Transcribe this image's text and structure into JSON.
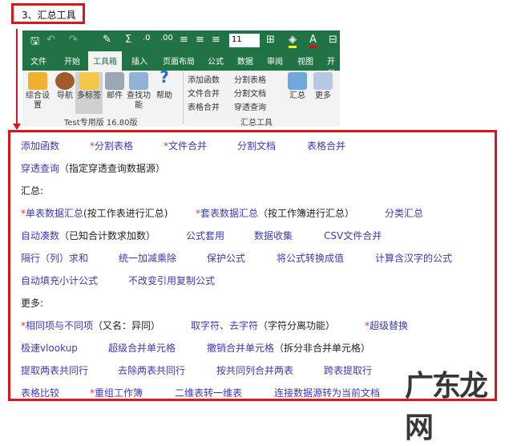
{
  "heading": "3、汇总工具",
  "ribbon": {
    "font_size": "11",
    "tabs": [
      "文件",
      "开始",
      "工具箱",
      "插入",
      "页面布局",
      "公式",
      "数据",
      "审阅",
      "视图",
      "开发"
    ],
    "active_tab": "工具箱",
    "big_buttons": [
      {
        "label": "综合设置",
        "icon": "settings-icon"
      },
      {
        "label": "导航",
        "icon": "helm-icon"
      },
      {
        "label": "多标签",
        "icon": "folder-icon"
      },
      {
        "label": "邮件",
        "icon": "mail-icon"
      },
      {
        "label": "查找功能",
        "icon": "search-icon"
      },
      {
        "label": "帮助",
        "icon": "help-icon"
      }
    ],
    "group1": "Test专用版 16.80版",
    "small_buttons": [
      "添加函数",
      "文件合并",
      "表格合并",
      "分割表格",
      "分割文档",
      "穿透查询"
    ],
    "summary_buttons": [
      "汇总",
      "更多"
    ],
    "group2": "汇总工具",
    "colors": {
      "green": "#217346"
    }
  },
  "rows": [
    [
      {
        "star": false,
        "link": "添加函数"
      },
      {
        "star": true,
        "link": "分割表格"
      },
      {
        "star": true,
        "link": "文件合并"
      },
      {
        "star": false,
        "link": "分割文档"
      },
      {
        "star": false,
        "link": "表格合并"
      }
    ],
    [
      {
        "star": false,
        "link": "穿透查询",
        "note": "（指定穿透查询数据源）"
      }
    ],
    [
      {
        "note": "汇总:"
      }
    ],
    [
      {
        "star": true,
        "link": "单表数据汇总",
        "note": "(按工作表进行汇总)"
      },
      {
        "star": true,
        "link": "套表数据汇总",
        "note": "（按工作簿进行汇总）"
      },
      {
        "link": "分类汇总"
      }
    ],
    [
      {
        "link": "自动凑数",
        "note": "（已知合计数求加数）"
      },
      {
        "link": "公式套用"
      },
      {
        "link": "数据收集"
      },
      {
        "link": "CSV文件合并"
      }
    ],
    [
      {
        "link": "隔行（列）求和"
      },
      {
        "link": "统一加减乘除"
      },
      {
        "link": "保护公式"
      },
      {
        "link": "将公式转换成值"
      },
      {
        "link": "计算含汉字的公式"
      }
    ],
    [
      {
        "link": "自动填充小计公式"
      },
      {
        "link": "不改变引用复制公式"
      }
    ],
    [
      {
        "note": "更多:"
      }
    ],
    [
      {
        "star": true,
        "link": "相同项与不同项",
        "note": "（又名：异同）"
      },
      {
        "link": "取字符、去字符",
        "note": "（字符分离功能）"
      },
      {
        "star": true,
        "link": "超级替换"
      }
    ],
    [
      {
        "link": "极速vlookup"
      },
      {
        "link": "超级合并单元格"
      },
      {
        "link": "撤销合并单元格",
        "note": "（拆分非合并单元格）"
      }
    ],
    [
      {
        "link": "提取两表共同行"
      },
      {
        "link": "去除两表共同行"
      },
      {
        "link": "按共同列合并两表"
      },
      {
        "link": "跨表提取行"
      }
    ],
    [
      {
        "link": "表格比较"
      },
      {
        "star": true,
        "link": "重组工作簿"
      },
      {
        "link": "二维表转一维表"
      },
      {
        "link": "连接数据源转为当前文档"
      }
    ]
  ],
  "star_symbol": "*",
  "watermark": "广东龙网",
  "colors": {
    "link": "#3b3bb8",
    "star": "#e0343a",
    "frame": "#d9161c"
  }
}
